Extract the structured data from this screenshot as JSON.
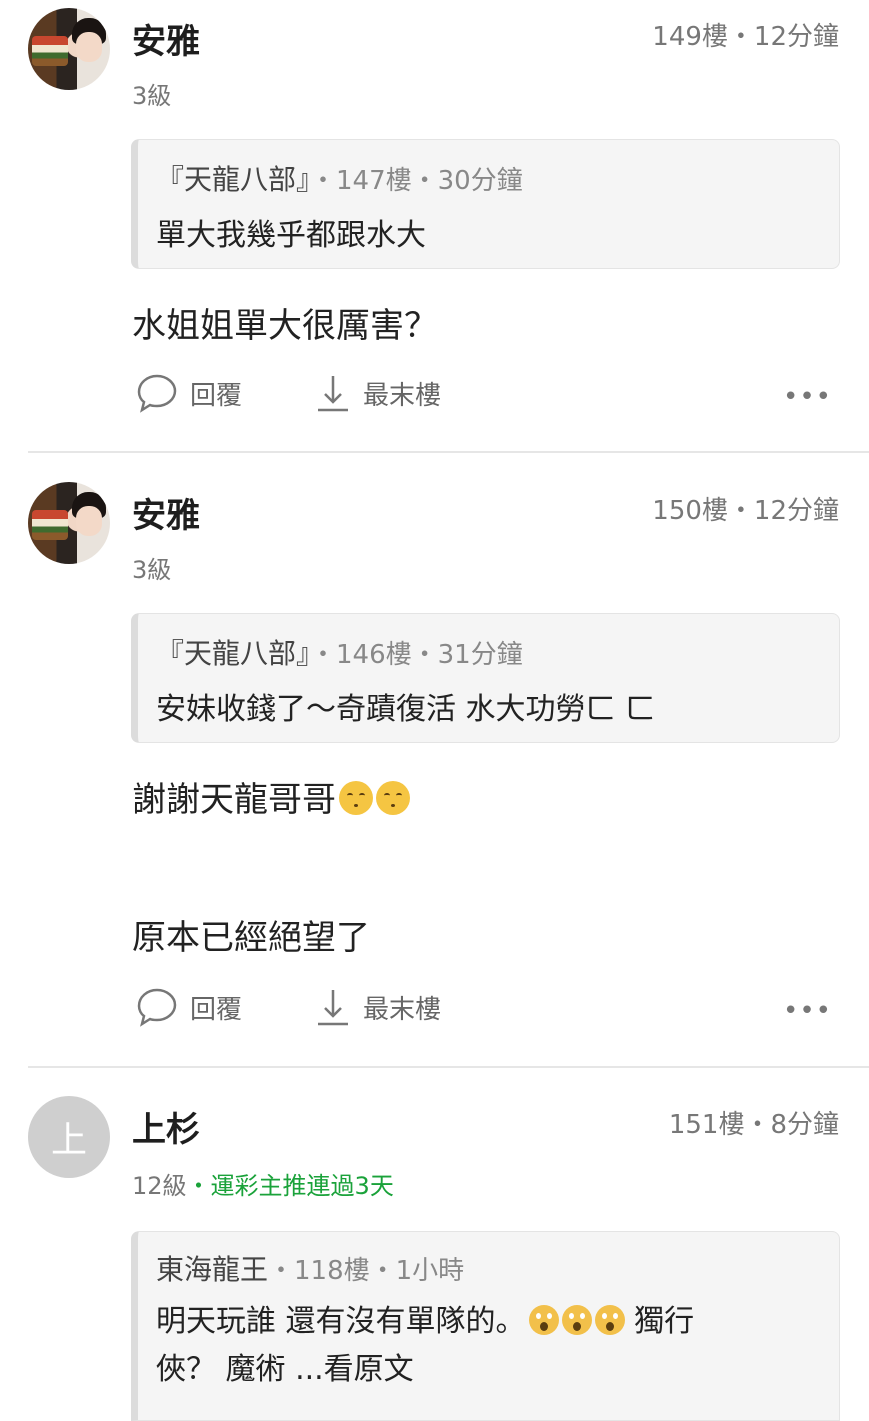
{
  "posts": [
    {
      "author": "安雅",
      "floor_time": "149樓・12分鐘",
      "level": "3級",
      "quote": {
        "author": "『天龍八部』",
        "meta": "・147樓・30分鐘",
        "text": "單大我幾乎都跟水大"
      },
      "body": [
        "水姐姐單大很厲害？"
      ],
      "reply_label": "回覆",
      "last_floor_label": "最末樓",
      "more_label": "•••"
    },
    {
      "author": "安雅",
      "floor_time": "150樓・12分鐘",
      "level": "3級",
      "quote": {
        "author": "『天龍八部』",
        "meta": "・146樓・31分鐘",
        "text": "安妹收錢了～奇蹟復活 水大功勞ㄈ ㄈ"
      },
      "body": [
        "謝謝天龍哥哥",
        "原本已經絕望了"
      ],
      "reply_label": "回覆",
      "last_floor_label": "最末樓",
      "more_label": "•••"
    },
    {
      "author": "上杉",
      "avatar_letter": "上",
      "floor_time": "151樓・8分鐘",
      "level": "12級",
      "badge": "・運彩主推連過3天",
      "quote": {
        "author": "東海龍王",
        "meta": "・118樓・1小時",
        "text_line1": "明天玩誰 還有沒有單隊的。",
        "text_line1_after": " 獨行",
        "text_line2": "俠？ 魔術 ...看原文"
      }
    }
  ],
  "colors": {
    "badge_green": "#1aa23a",
    "meta_gray": "#777777",
    "quote_bg": "#f5f5f5"
  },
  "icons": {
    "reply": "speech-bubble-icon",
    "last_floor": "arrow-down-to-line-icon",
    "more": "more-dots-icon"
  }
}
